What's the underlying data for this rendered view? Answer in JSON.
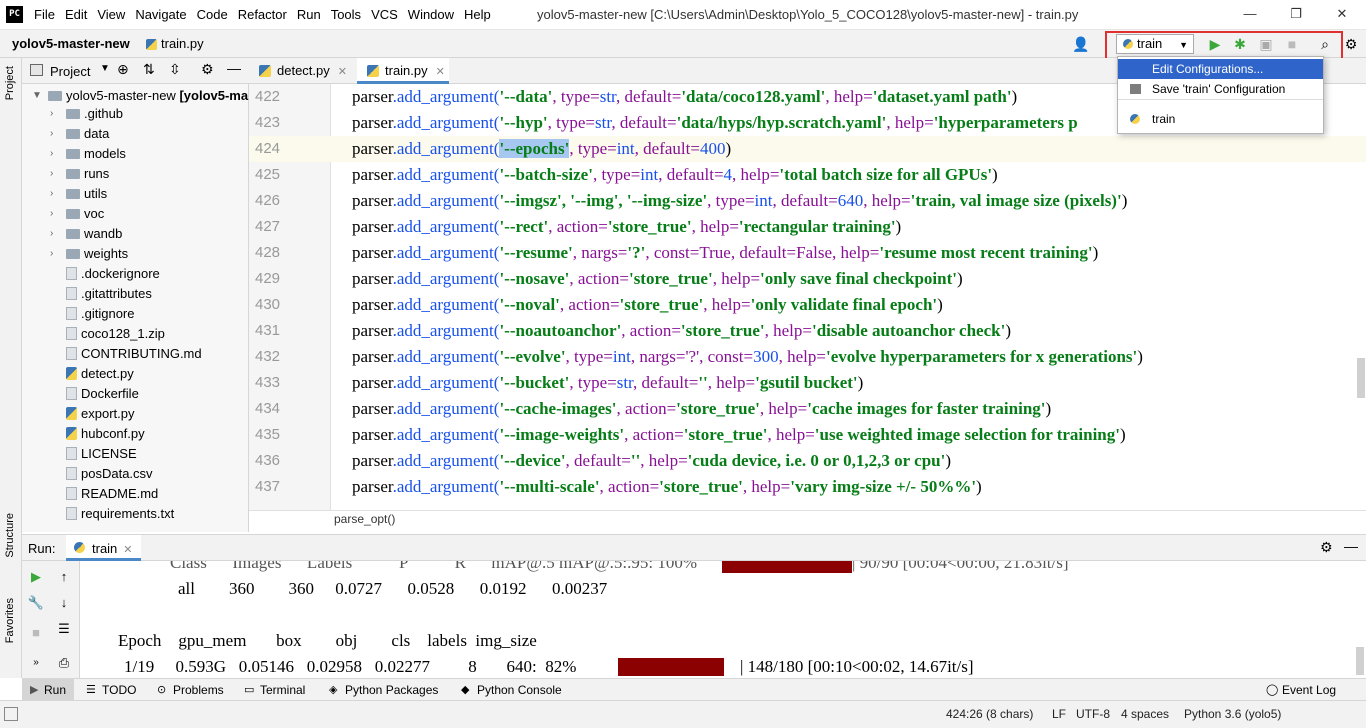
{
  "app": {
    "logo": "PC",
    "menus": [
      "File",
      "Edit",
      "View",
      "Navigate",
      "Code",
      "Refactor",
      "Run",
      "Tools",
      "VCS",
      "Window",
      "Help"
    ],
    "window_title": "yolov5-master-new [C:\\Users\\Admin\\Desktop\\Yolo_5_COCO128\\yolov5-master-new] - train.py",
    "win_min": "—",
    "win_max": "❐",
    "win_close": "✕"
  },
  "navbar": {
    "project": "yolov5-master-new",
    "file": "train.py",
    "run_config": "train"
  },
  "run_menu": {
    "items": [
      "Edit Configurations...",
      "Save 'train' Configuration",
      "train"
    ]
  },
  "project_panel": {
    "title": "Project",
    "root": "yolov5-master-new",
    "root_suffix": "[yolov5-ma",
    "items": [
      {
        "name": ".github",
        "type": "folder"
      },
      {
        "name": "data",
        "type": "folder"
      },
      {
        "name": "models",
        "type": "folder"
      },
      {
        "name": "runs",
        "type": "folder"
      },
      {
        "name": "utils",
        "type": "folder"
      },
      {
        "name": "voc",
        "type": "folder"
      },
      {
        "name": "wandb",
        "type": "folder"
      },
      {
        "name": "weights",
        "type": "folder"
      },
      {
        "name": ".dockerignore",
        "type": "file"
      },
      {
        "name": ".gitattributes",
        "type": "file"
      },
      {
        "name": ".gitignore",
        "type": "file"
      },
      {
        "name": "coco128_1.zip",
        "type": "file"
      },
      {
        "name": "CONTRIBUTING.md",
        "type": "file"
      },
      {
        "name": "detect.py",
        "type": "py"
      },
      {
        "name": "Dockerfile",
        "type": "file"
      },
      {
        "name": "export.py",
        "type": "py"
      },
      {
        "name": "hubconf.py",
        "type": "py"
      },
      {
        "name": "LICENSE",
        "type": "file"
      },
      {
        "name": "posData.csv",
        "type": "file"
      },
      {
        "name": "README.md",
        "type": "file"
      },
      {
        "name": "requirements.txt",
        "type": "file"
      }
    ]
  },
  "editor": {
    "tabs": [
      "detect.py",
      "train.py"
    ],
    "breadcrumb": "parse_opt()",
    "lines": [
      {
        "n": "422",
        "arg": "'--data'",
        "rest_a": ", type=",
        "t": "str",
        "rest_b": ", default=",
        "d": "'data/coco128.yaml'",
        "rest_c": ", help=",
        "h": "'dataset.yaml path'",
        "end": ")"
      },
      {
        "n": "423",
        "arg": "'--hyp'",
        "rest_a": ", type=",
        "t": "str",
        "rest_b": ", default=",
        "d": "'data/hyps/hyp.scratch.yaml'",
        "rest_c": ", help=",
        "h": "'hyperparameters p",
        "end": ""
      },
      {
        "n": "424",
        "arg": "'--epochs'",
        "rest_a": ", type=",
        "t": "int",
        "rest_b": ", default=",
        "d": "400",
        "rest_c": "",
        "h": "",
        "end": ")"
      },
      {
        "n": "425",
        "arg": "'--batch-size'",
        "rest_a": ", type=",
        "t": "int",
        "rest_b": ", default=",
        "d": "4",
        "rest_c": ", help=",
        "h": "'total batch size for all GPUs'",
        "end": ")"
      },
      {
        "n": "426",
        "arg": "'--imgsz', '--img', '--img-size'",
        "rest_a": ", type=",
        "t": "int",
        "rest_b": ", default=",
        "d": "640",
        "rest_c": ", help=",
        "h": "'train, val image size (pixels)'",
        "end": ")"
      },
      {
        "n": "427",
        "arg": "'--rect'",
        "rest_a": ", action=",
        "t": "'store_true'",
        "rest_b": "",
        "d": "",
        "rest_c": ", help=",
        "h": "'rectangular training'",
        "end": ")"
      },
      {
        "n": "428",
        "arg": "'--resume'",
        "rest_a": ", nargs=",
        "t": "'?'",
        "rest_b": ", const=True, default=False",
        "d": "",
        "rest_c": ", help=",
        "h": "'resume most recent training'",
        "end": ")"
      },
      {
        "n": "429",
        "arg": "'--nosave'",
        "rest_a": ", action=",
        "t": "'store_true'",
        "rest_b": "",
        "d": "",
        "rest_c": ", help=",
        "h": "'only save final checkpoint'",
        "end": ")"
      },
      {
        "n": "430",
        "arg": "'--noval'",
        "rest_a": ", action=",
        "t": "'store_true'",
        "rest_b": "",
        "d": "",
        "rest_c": ", help=",
        "h": "'only validate final epoch'",
        "end": ")"
      },
      {
        "n": "431",
        "arg": "'--noautoanchor'",
        "rest_a": ", action=",
        "t": "'store_true'",
        "rest_b": "",
        "d": "",
        "rest_c": ", help=",
        "h": "'disable autoanchor check'",
        "end": ")"
      },
      {
        "n": "432",
        "arg": "'--evolve'",
        "rest_a": ", type=",
        "t": "int",
        "rest_b": ", nargs='?', const=",
        "d": "300",
        "rest_c": ", help=",
        "h": "'evolve hyperparameters for x generations'",
        "end": ")"
      },
      {
        "n": "433",
        "arg": "'--bucket'",
        "rest_a": ", type=",
        "t": "str",
        "rest_b": ", default=",
        "d": "''",
        "rest_c": ", help=",
        "h": "'gsutil bucket'",
        "end": ")"
      },
      {
        "n": "434",
        "arg": "'--cache-images'",
        "rest_a": ", action=",
        "t": "'store_true'",
        "rest_b": "",
        "d": "",
        "rest_c": ", help=",
        "h": "'cache images for faster training'",
        "end": ")"
      },
      {
        "n": "435",
        "arg": "'--image-weights'",
        "rest_a": ", action=",
        "t": "'store_true'",
        "rest_b": "",
        "d": "",
        "rest_c": ", help=",
        "h": "'use weighted image selection for training'",
        "end": ")"
      },
      {
        "n": "436",
        "arg": "'--device'",
        "rest_a": ", default=",
        "t": "''",
        "rest_b": "",
        "d": "",
        "rest_c": ", help=",
        "h": "'cuda device, i.e. 0 or 0,1,2,3 or cpu'",
        "end": ")"
      },
      {
        "n": "437",
        "arg": "'--multi-scale'",
        "rest_a": ", action=",
        "t": "'store_true'",
        "rest_b": "",
        "d": "",
        "rest_c": ", help=",
        "h": "'vary img-size +/- 50%%'",
        "end": ")"
      }
    ],
    "prefix": "parser",
    "method": ".add_argument("
  },
  "run_panel": {
    "label": "Run:",
    "tab": "train",
    "out_header": "Class      Images      Labels           P           R      mAP@.5 mAP@.5:.95: 100%",
    "out_header_tail": "| 90/90 [00:04<00:00, 21.83it/s]",
    "out_all": "all        360        360     0.0727      0.0528      0.0192      0.00237",
    "out_epoch_header": "Epoch    gpu_mem       box        obj        cls    labels  img_size",
    "out_epoch": "1/19     0.593G   0.05146   0.02958   0.02277         8       640:  82%",
    "out_epoch_tail": "| 148/180 [00:10<00:02, 14.67it/s]"
  },
  "bottom_tabs": [
    "Run",
    "TODO",
    "Problems",
    "Terminal",
    "Python Packages",
    "Python Console"
  ],
  "event_log": "Event Log",
  "side_labels": {
    "project": "Project",
    "structure": "Structure",
    "favorites": "Favorites"
  },
  "status": {
    "position": "424:26 (8 chars)",
    "line_sep": "LF",
    "encoding": "UTF-8",
    "indent": "4 spaces",
    "interpreter": "Python 3.6 (yolo5)"
  }
}
